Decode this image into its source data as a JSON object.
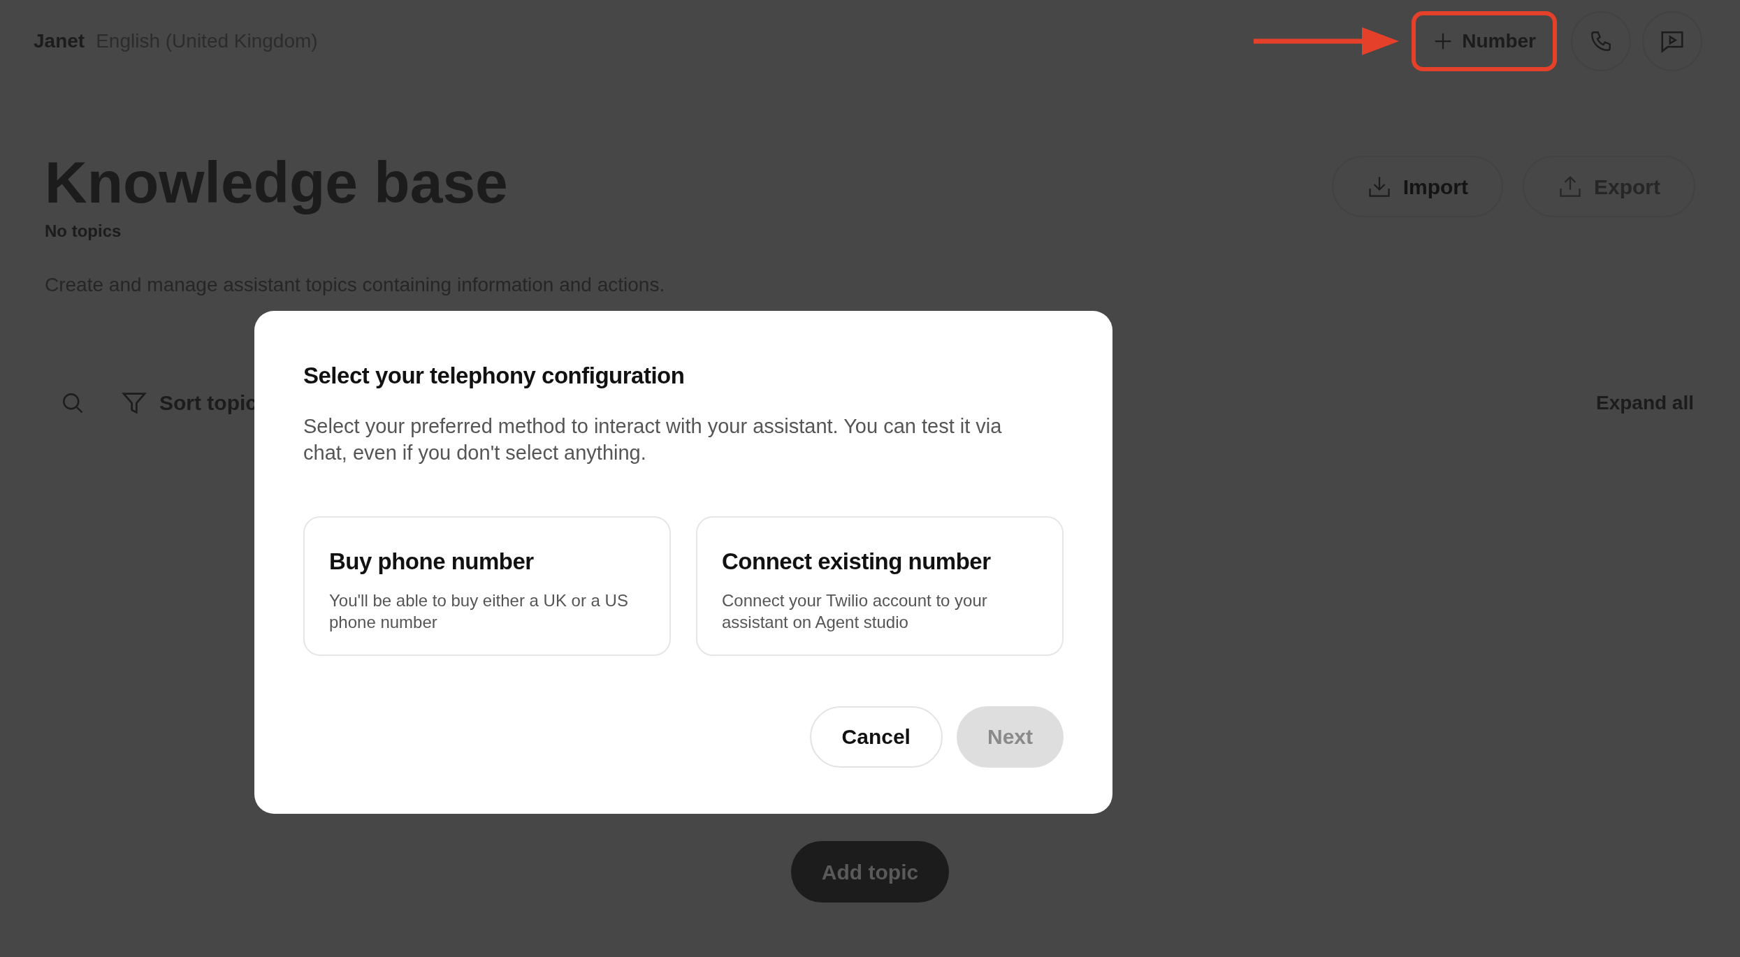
{
  "header": {
    "name": "Janet",
    "language": "English (United Kingdom)",
    "number_button": {
      "label": "Number",
      "highlighted": true
    }
  },
  "page": {
    "title": "Knowledge base",
    "subtitle": "No topics",
    "description": "Create and manage assistant topics containing information and actions.",
    "import_button": {
      "label": "Import",
      "disabled": false
    },
    "export_button": {
      "label": "Export",
      "disabled": true
    },
    "toolbar": {
      "sort_label": "Sort topic",
      "expand_all": "Expand all"
    },
    "add_topic": "Add topic"
  },
  "dialog": {
    "title": "Select your telephony configuration",
    "description": "Select your preferred method to interact with your assistant. You can test it via chat, even if you don't select anything.",
    "options": [
      {
        "title": "Buy phone number",
        "description": "You'll be able to buy either a UK or a US phone number",
        "selected": false
      },
      {
        "title": "Connect existing number",
        "description": "Connect your Twilio account to your assistant on Agent studio",
        "selected": false
      }
    ],
    "buttons": [
      {
        "label": "Cancel",
        "disabled": false
      },
      {
        "label": "Next",
        "disabled": true
      }
    ]
  }
}
